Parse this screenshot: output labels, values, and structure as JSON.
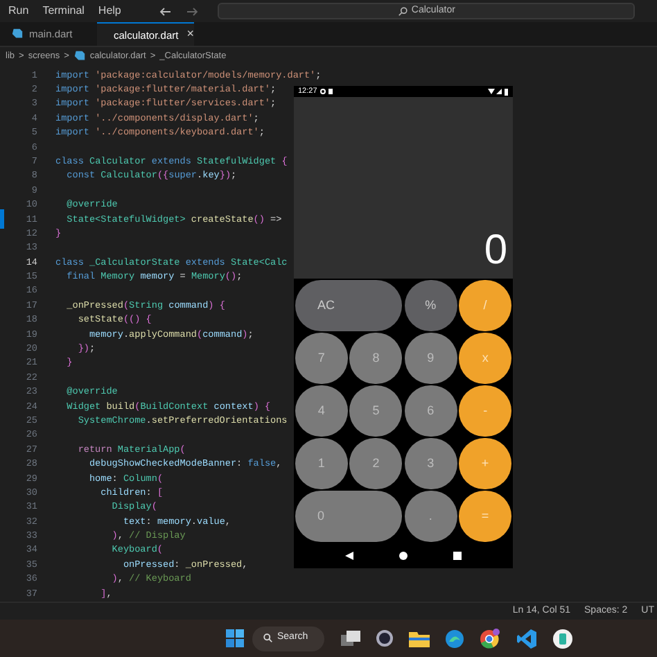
{
  "menu": [
    "Run",
    "Terminal",
    "Help"
  ],
  "search": {
    "value": "Calculator"
  },
  "tabs": [
    {
      "label": "main.dart",
      "selected": false
    },
    {
      "label": "calculator.dart",
      "selected": true,
      "close": "×"
    }
  ],
  "breadcrumb": [
    "lib",
    "screens",
    "calculator.dart",
    "_CalculatorState"
  ],
  "breadcrumb_sep": ">",
  "code": {
    "lines": [
      {
        "n": "1",
        "current": false,
        "segs": [
          {
            "kind": "kw",
            "text": "import "
          },
          {
            "kind": "str",
            "text": "'package:calculator/models/memory.dart'"
          },
          {
            "kind": "pl",
            "text": ";"
          }
        ]
      },
      {
        "n": "2",
        "current": false,
        "segs": [
          {
            "kind": "kw",
            "text": "import "
          },
          {
            "kind": "str",
            "text": "'package:flutter/material.dart'"
          },
          {
            "kind": "pl",
            "text": ";"
          }
        ]
      },
      {
        "n": "3",
        "current": false,
        "segs": [
          {
            "kind": "kw",
            "text": "import "
          },
          {
            "kind": "str",
            "text": "'package:flutter/services.dart'"
          },
          {
            "kind": "pl",
            "text": ";"
          }
        ]
      },
      {
        "n": "4",
        "current": false,
        "segs": [
          {
            "kind": "kw",
            "text": "import "
          },
          {
            "kind": "str",
            "text": "'../components/display.dart'"
          },
          {
            "kind": "pl",
            "text": ";"
          }
        ]
      },
      {
        "n": "5",
        "current": false,
        "segs": [
          {
            "kind": "kw",
            "text": "import "
          },
          {
            "kind": "str",
            "text": "'../components/keyboard.dart'"
          },
          {
            "kind": "pl",
            "text": ";"
          }
        ]
      },
      {
        "n": "6",
        "current": false
      },
      {
        "n": "7",
        "current": false,
        "segs": [
          {
            "kind": "kw",
            "text": "class "
          },
          {
            "kind": "ty",
            "text": "Calculator "
          },
          {
            "kind": "kw",
            "text": "extends "
          },
          {
            "kind": "ty",
            "text": "StatefulWidget "
          },
          {
            "kind": "br",
            "text": "{"
          }
        ]
      },
      {
        "n": "8",
        "current": false,
        "segs": [
          {
            "kind": "kw",
            "text": "  const "
          },
          {
            "kind": "ty",
            "text": "Calculator"
          },
          {
            "kind": "br",
            "text": "({"
          },
          {
            "kind": "kw",
            "text": "super"
          },
          {
            "kind": "pl",
            "text": "."
          },
          {
            "kind": "var",
            "text": "key"
          },
          {
            "kind": "br",
            "text": "})"
          },
          {
            "kind": "pl",
            "text": ";"
          }
        ]
      },
      {
        "n": "9",
        "current": false
      },
      {
        "n": "10",
        "current": false,
        "segs": [
          {
            "kind": "ty",
            "text": "  @override"
          }
        ]
      },
      {
        "n": "11",
        "current": false,
        "segs": [
          {
            "kind": "ty",
            "text": "  State<StatefulWidget> "
          },
          {
            "kind": "fn",
            "text": "createState"
          },
          {
            "kind": "br",
            "text": "()"
          },
          {
            "kind": "pl",
            "text": " =>"
          }
        ]
      },
      {
        "n": "12",
        "current": false,
        "segs": [
          {
            "kind": "br",
            "text": "}"
          }
        ]
      },
      {
        "n": "13",
        "current": false
      },
      {
        "n": "14",
        "current": true,
        "segs": [
          {
            "kind": "kw",
            "text": "class "
          },
          {
            "kind": "ty",
            "text": "_CalculatorState "
          },
          {
            "kind": "kw",
            "text": "extends "
          },
          {
            "kind": "ty",
            "text": "State<Calc"
          }
        ]
      },
      {
        "n": "15",
        "current": false,
        "segs": [
          {
            "kind": "kw",
            "text": "  final "
          },
          {
            "kind": "ty",
            "text": "Memory "
          },
          {
            "kind": "var",
            "text": "memory"
          },
          {
            "kind": "pl",
            "text": " = "
          },
          {
            "kind": "ty",
            "text": "Memory"
          },
          {
            "kind": "br",
            "text": "()"
          },
          {
            "kind": "pl",
            "text": ";"
          }
        ]
      },
      {
        "n": "16",
        "current": false
      },
      {
        "n": "17",
        "current": false,
        "segs": [
          {
            "kind": "fn",
            "text": "  _onPressed"
          },
          {
            "kind": "br",
            "text": "("
          },
          {
            "kind": "ty",
            "text": "String "
          },
          {
            "kind": "var",
            "text": "command"
          },
          {
            "kind": "br",
            "text": ") {"
          }
        ]
      },
      {
        "n": "18",
        "current": false,
        "segs": [
          {
            "kind": "fn",
            "text": "    setState"
          },
          {
            "kind": "br",
            "text": "(() {"
          }
        ]
      },
      {
        "n": "19",
        "current": false,
        "segs": [
          {
            "kind": "var",
            "text": "      memory"
          },
          {
            "kind": "pl",
            "text": "."
          },
          {
            "kind": "fn",
            "text": "applyCommand"
          },
          {
            "kind": "br",
            "text": "("
          },
          {
            "kind": "var",
            "text": "command"
          },
          {
            "kind": "br",
            "text": ")"
          },
          {
            "kind": "pl",
            "text": ";"
          }
        ]
      },
      {
        "n": "20",
        "current": false,
        "segs": [
          {
            "kind": "br",
            "text": "    })"
          },
          {
            "kind": "pl",
            "text": ";"
          }
        ]
      },
      {
        "n": "21",
        "current": false,
        "segs": [
          {
            "kind": "br",
            "text": "  }"
          }
        ]
      },
      {
        "n": "22",
        "current": false
      },
      {
        "n": "23",
        "current": false,
        "segs": [
          {
            "kind": "ty",
            "text": "  @override"
          }
        ]
      },
      {
        "n": "24",
        "current": false,
        "segs": [
          {
            "kind": "ty",
            "text": "  Widget "
          },
          {
            "kind": "fn",
            "text": "build"
          },
          {
            "kind": "br",
            "text": "("
          },
          {
            "kind": "ty",
            "text": "BuildContext "
          },
          {
            "kind": "var",
            "text": "context"
          },
          {
            "kind": "br",
            "text": ") {"
          }
        ]
      },
      {
        "n": "25",
        "current": false,
        "segs": [
          {
            "kind": "ty",
            "text": "    SystemChrome"
          },
          {
            "kind": "pl",
            "text": "."
          },
          {
            "kind": "fn",
            "text": "setPreferredOrientations"
          }
        ]
      },
      {
        "n": "26",
        "current": false
      },
      {
        "n": "27",
        "current": false,
        "segs": [
          {
            "kind": "ctl",
            "text": "    return "
          },
          {
            "kind": "ty",
            "text": "MaterialApp"
          },
          {
            "kind": "br",
            "text": "("
          }
        ]
      },
      {
        "n": "28",
        "current": false,
        "segs": [
          {
            "kind": "var",
            "text": "      debugShowCheckedModeBanner"
          },
          {
            "kind": "pl",
            "text": ": "
          },
          {
            "kind": "kw",
            "text": "false"
          },
          {
            "kind": "pl",
            "text": ","
          }
        ]
      },
      {
        "n": "29",
        "current": false,
        "segs": [
          {
            "kind": "var",
            "text": "      home"
          },
          {
            "kind": "pl",
            "text": ": "
          },
          {
            "kind": "ty",
            "text": "Column"
          },
          {
            "kind": "br",
            "text": "("
          }
        ]
      },
      {
        "n": "30",
        "current": false,
        "segs": [
          {
            "kind": "var",
            "text": "        children"
          },
          {
            "kind": "pl",
            "text": ": "
          },
          {
            "kind": "br",
            "text": "["
          }
        ]
      },
      {
        "n": "31",
        "current": false,
        "segs": [
          {
            "kind": "ty",
            "text": "          Display"
          },
          {
            "kind": "br",
            "text": "("
          }
        ]
      },
      {
        "n": "32",
        "current": false,
        "segs": [
          {
            "kind": "var",
            "text": "            text"
          },
          {
            "kind": "pl",
            "text": ": "
          },
          {
            "kind": "var",
            "text": "memory"
          },
          {
            "kind": "pl",
            "text": "."
          },
          {
            "kind": "var",
            "text": "value"
          },
          {
            "kind": "pl",
            "text": ","
          }
        ]
      },
      {
        "n": "33",
        "current": false,
        "segs": [
          {
            "kind": "br",
            "text": "          )"
          },
          {
            "kind": "pl",
            "text": ", "
          },
          {
            "kind": "com",
            "text": "// Display"
          }
        ]
      },
      {
        "n": "34",
        "current": false,
        "segs": [
          {
            "kind": "ty",
            "text": "          Keyboard"
          },
          {
            "kind": "br",
            "text": "("
          }
        ]
      },
      {
        "n": "35",
        "current": false,
        "segs": [
          {
            "kind": "var",
            "text": "            onPressed"
          },
          {
            "kind": "pl",
            "text": ": "
          },
          {
            "kind": "fn",
            "text": "_onPressed"
          },
          {
            "kind": "pl",
            "text": ","
          }
        ]
      },
      {
        "n": "36",
        "current": false,
        "segs": [
          {
            "kind": "br",
            "text": "          )"
          },
          {
            "kind": "pl",
            "text": ", "
          },
          {
            "kind": "com",
            "text": "// Keyboard"
          }
        ]
      },
      {
        "n": "37",
        "current": false,
        "segs": [
          {
            "kind": "br",
            "text": "        ]"
          },
          {
            "kind": "pl",
            "text": ","
          }
        ]
      }
    ]
  },
  "emulator": {
    "time": "12:27",
    "display": "0",
    "keys": [
      {
        "label": "AC",
        "kind": "func",
        "wide": true
      },
      {
        "label": "%",
        "kind": "func",
        "wide": false
      },
      {
        "label": "/",
        "kind": "op",
        "wide": false
      },
      {
        "label": "7",
        "kind": "num",
        "wide": false
      },
      {
        "label": "8",
        "kind": "num",
        "wide": false
      },
      {
        "label": "9",
        "kind": "num",
        "wide": false
      },
      {
        "label": "x",
        "kind": "op",
        "wide": false
      },
      {
        "label": "4",
        "kind": "num",
        "wide": false
      },
      {
        "label": "5",
        "kind": "num",
        "wide": false
      },
      {
        "label": "6",
        "kind": "num",
        "wide": false
      },
      {
        "label": "-",
        "kind": "op",
        "wide": false
      },
      {
        "label": "1",
        "kind": "num",
        "wide": false
      },
      {
        "label": "2",
        "kind": "num",
        "wide": false
      },
      {
        "label": "3",
        "kind": "num",
        "wide": false
      },
      {
        "label": "+",
        "kind": "op",
        "wide": false
      },
      {
        "label": "0",
        "kind": "num",
        "wide": true
      },
      {
        "label": ".",
        "kind": "num",
        "wide": false
      },
      {
        "label": "=",
        "kind": "op",
        "wide": false
      }
    ]
  },
  "status_bar": [
    "Ln 14, Col 51",
    "Spaces: 2",
    "UT"
  ],
  "taskbar": {
    "search": "Search"
  }
}
